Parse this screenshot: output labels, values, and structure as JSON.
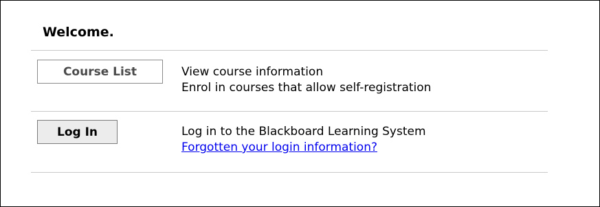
{
  "welcome_heading": "Welcome.",
  "rows": [
    {
      "button_label": "Course List",
      "lines": [
        "View course information",
        "Enrol in courses that allow self-registration"
      ]
    },
    {
      "button_label": "Log In",
      "line": "Log in to the Blackboard Learning System",
      "link_text": "Forgotten your login information?"
    }
  ],
  "colors": {
    "link": "#0000ee",
    "divider": "#c8c8c8",
    "frame_border": "#000000"
  }
}
